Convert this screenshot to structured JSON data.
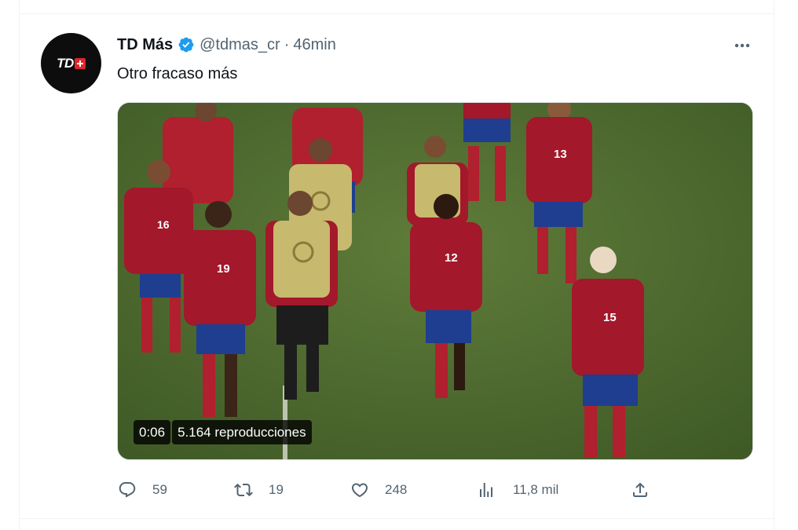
{
  "tweet": {
    "author_name": "TD Más",
    "handle": "@tdmas_cr",
    "separator": "·",
    "time": "46min",
    "text": "Otro fracaso más",
    "avatar_text": "TD"
  },
  "video": {
    "duration": "0:06",
    "views": "5.164 reproducciones",
    "jerseys": [
      "16",
      "19",
      "12",
      "13",
      "15"
    ]
  },
  "actions": {
    "replies": "59",
    "retweets": "19",
    "likes": "248",
    "views": "11,8 mil"
  },
  "icons": {
    "verified": "verified-badge-icon",
    "more": "more-horizontal-icon",
    "reply": "reply-icon",
    "retweet": "retweet-icon",
    "like": "heart-icon",
    "views": "analytics-icon",
    "share": "share-icon"
  },
  "colors": {
    "verified": "#1d9bf0",
    "text_secondary": "#536471",
    "jersey_red": "#a3182a",
    "shorts_blue": "#1f3e8f",
    "pitch": "#4f6b30"
  }
}
